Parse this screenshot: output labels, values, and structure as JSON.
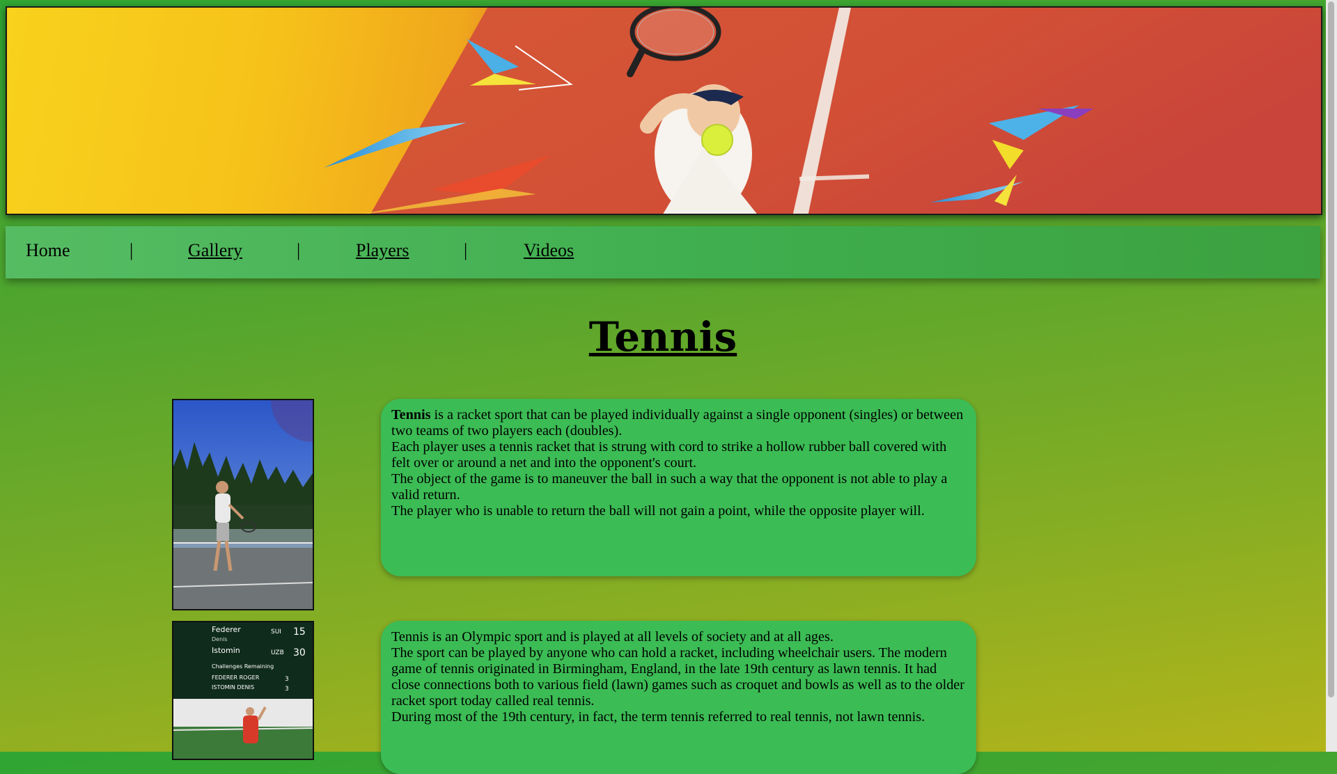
{
  "banner": {
    "alt": "Tennis banner - young player serving on clay court"
  },
  "nav": {
    "items": [
      {
        "label": "Home",
        "link": false
      },
      {
        "label": "|",
        "link": false
      },
      {
        "label": "Gallery",
        "link": true
      },
      {
        "label": "|",
        "link": false
      },
      {
        "label": "Players",
        "link": true
      },
      {
        "label": "|",
        "link": false
      },
      {
        "label": "Videos",
        "link": true
      }
    ]
  },
  "page": {
    "title": "Tennis"
  },
  "photo2": {
    "scoreboard": {
      "row1_name": "Federer",
      "row1_sub": "Denis",
      "row1_country": "SUI",
      "row1_score": "15",
      "row2_name": "Istomin",
      "row2_country": "UZB",
      "row2_score": "30",
      "challenges_label": "Challenges Remaining",
      "challenger1": "FEDERER ROGER",
      "challenger1_count": "3",
      "challenger2": "ISTOMIN DENIS",
      "challenger2_count": "3"
    }
  },
  "section1": {
    "lead_bold": "Tennis",
    "lead_rest": " is a racket sport that can be played individually against a single opponent (singles) or between two teams of two players each (doubles).",
    "line2": "Each player uses a tennis racket that is strung with cord to strike a hollow rubber ball covered with felt over or around a net and into the opponent's court.",
    "line3": "The object of the game is to maneuver the ball in such a way that the opponent is not able to play a valid return.",
    "line4": "The player who is unable to return the ball will not gain a point, while the opposite player will."
  },
  "section2": {
    "line1": "Tennis is an Olympic sport and is played at all levels of society and at all ages.",
    "line2": "The sport can be played by anyone who can hold a racket, including wheelchair users. The modern game of tennis originated in Birmingham, England, in the late 19th century as lawn tennis. It had close connections both to various field (lawn) games such as croquet and bowls as well as to the older racket sport today called real tennis.",
    "line3": "During most of the 19th century, in fact, the term tennis referred to real tennis, not lawn tennis."
  },
  "colors": {
    "nav_bg": "#4fb55c",
    "box_bg": "#3cbc55",
    "clay": "#d5573a"
  }
}
